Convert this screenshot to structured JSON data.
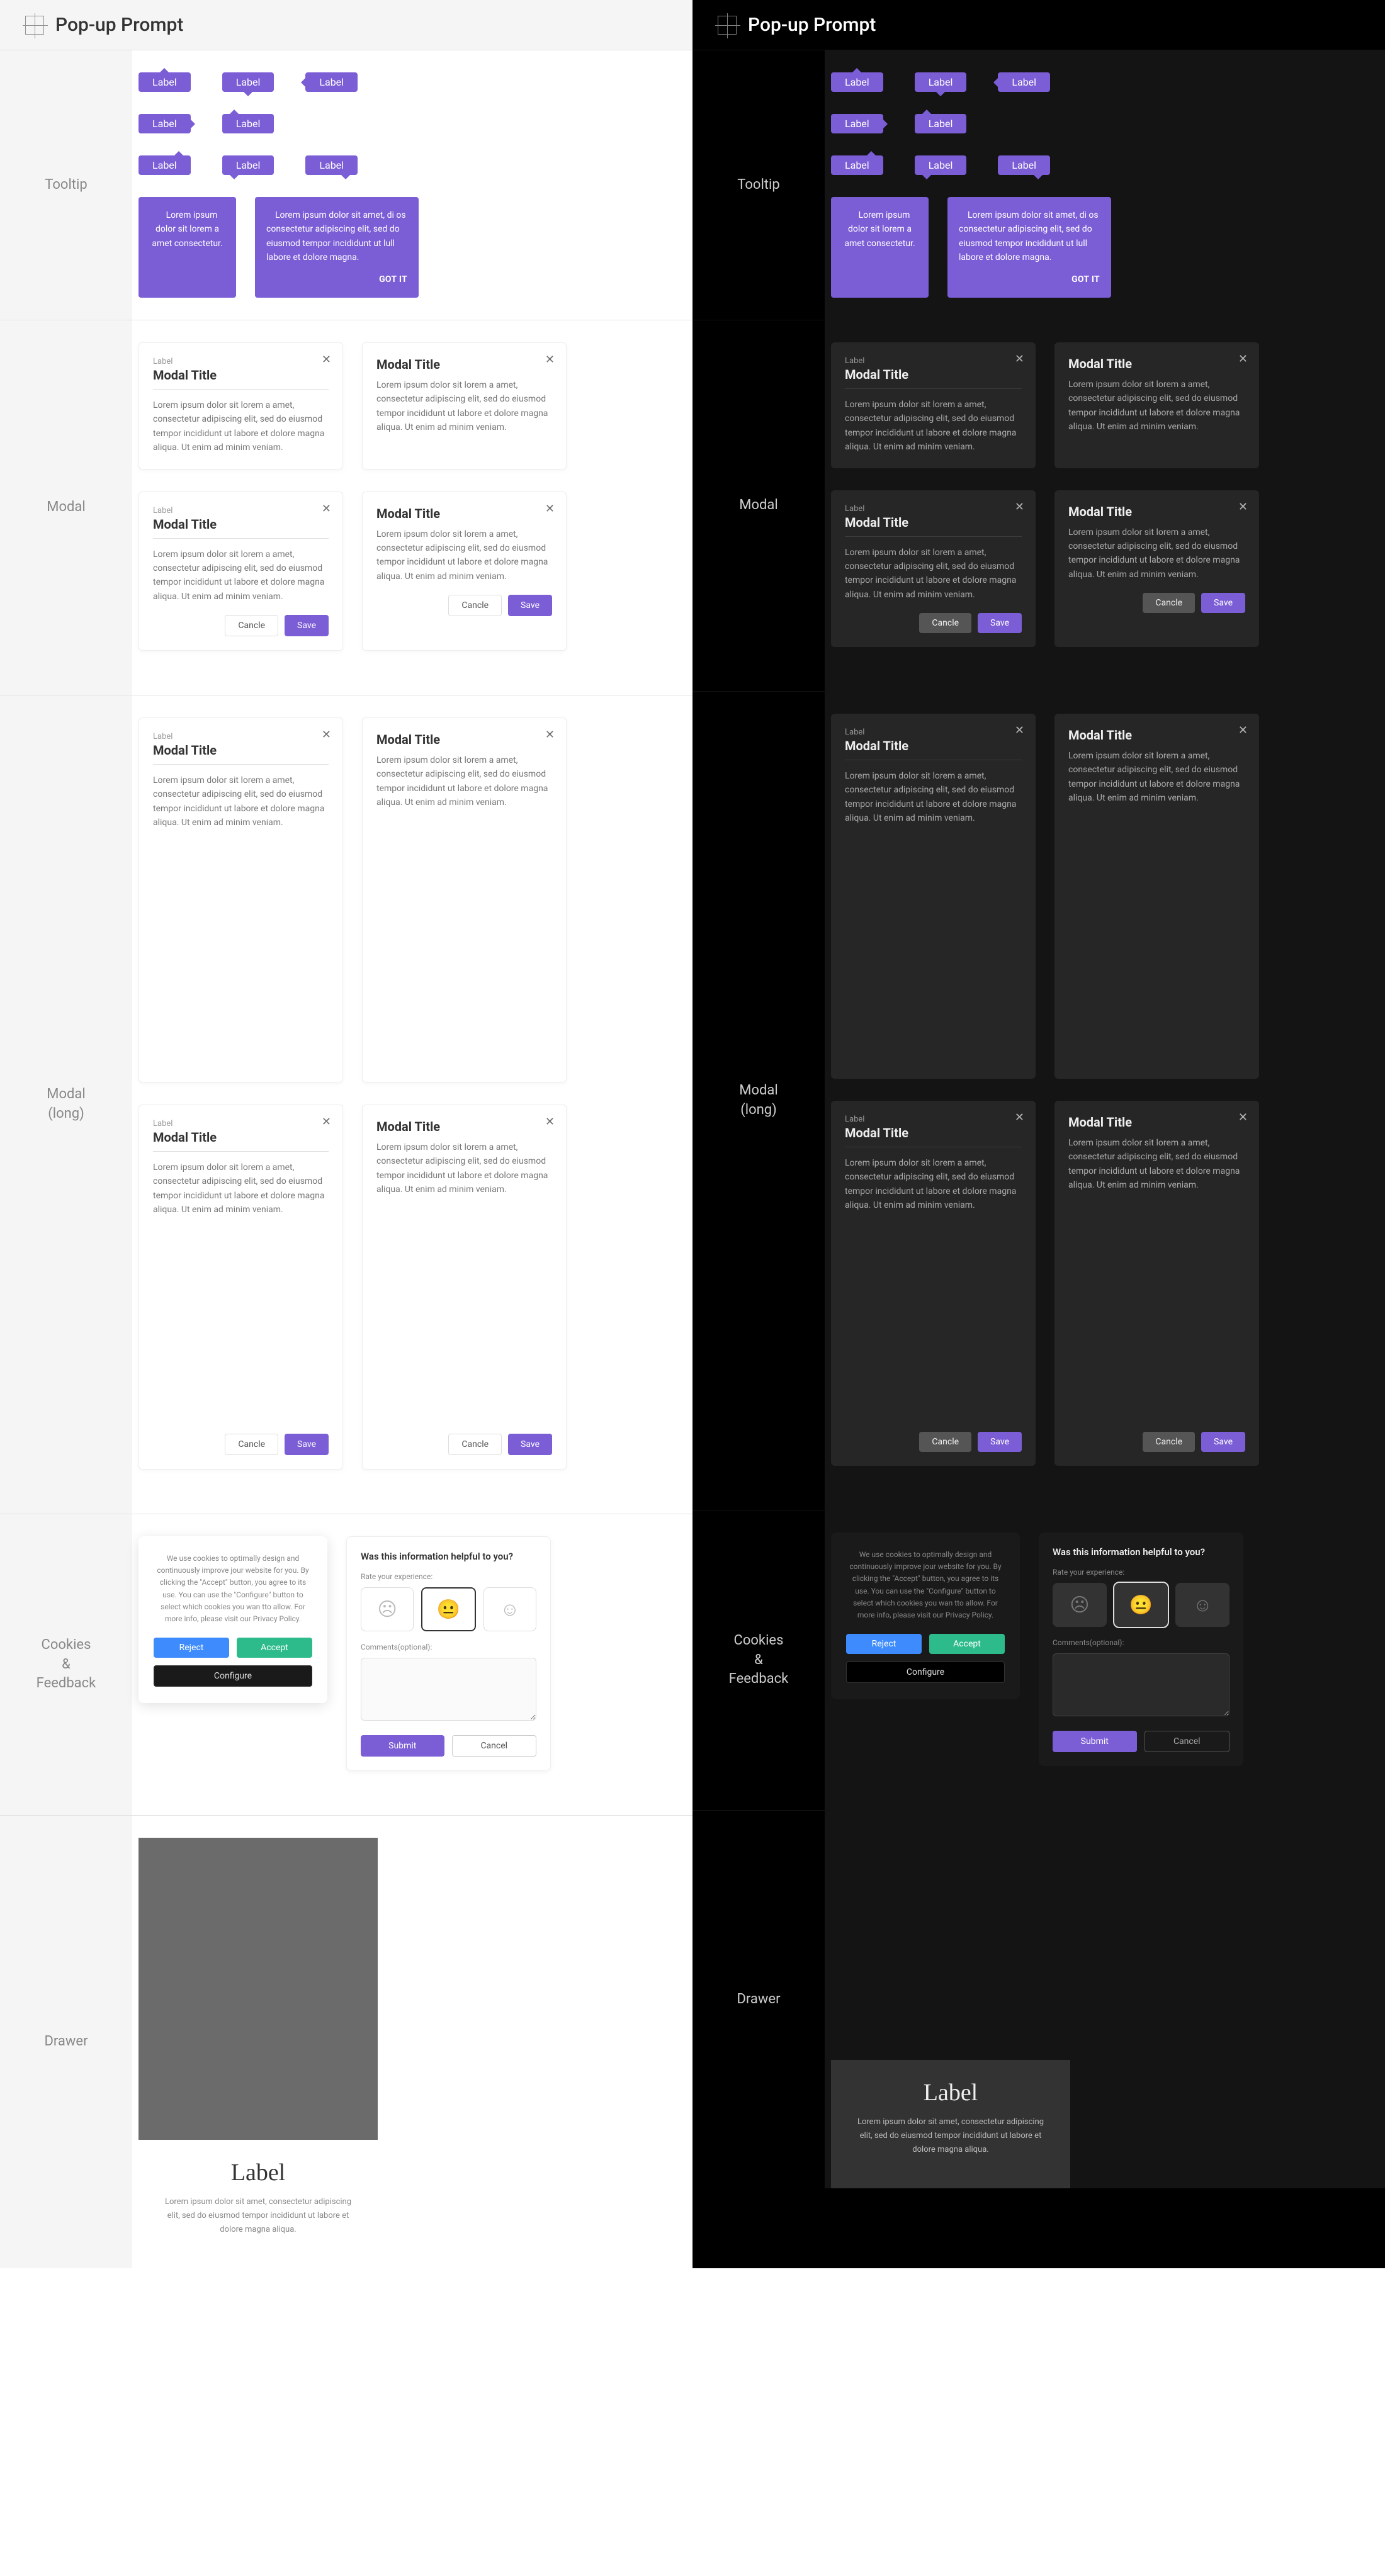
{
  "header": {
    "title": "Pop-up Prompt"
  },
  "sections": {
    "tooltip": "Tooltip",
    "modal": "Modal",
    "modal_long": "Modal\n(long)",
    "cookies": "Cookies\n&\nFeedback",
    "drawer": "Drawer"
  },
  "tooltip": {
    "label": "Label",
    "short": "Lorem ipsum dolor sit lorem a amet consectetur.",
    "long": "Lorem ipsum dolor sit amet, di os consectetur adipiscing elit, sed do eiusmod tempor incididunt ut lull labore et dolore magna.",
    "gotit": "GOT IT"
  },
  "modal": {
    "overline": "Label",
    "title": "Modal Title",
    "body_short": "Lorem ipsum dolor sit lorem a amet, consectetur adipiscing elit, sed do eiusmod tempor incididunt ut labore et dolore magna aliqua. Ut enim ad minim veniam.",
    "body_long": "Lorem ipsum dolor sit lorem a amet, consectetur adipiscing elit, sed do eiusmod tempor incididunt ut labore et dolore magna aliqua. Ut enim ad minim veniam.",
    "cancel": "Cancle",
    "save": "Save"
  },
  "cookies": {
    "text": "We use cookies to optimally design and continuously improve jour website for you. By clicking the \"Accept\" button, you agree to its use. You can use the \"Configure\" button to select which cookies you wan tto allow. For more info, please visit our Privacy Policy.",
    "reject": "Reject",
    "accept": "Accept",
    "configure": "Configure"
  },
  "feedback": {
    "question": "Was this information helpful to you?",
    "rate_label": "Rate your experience:",
    "comments_label": "Comments(optional):",
    "submit": "Submit",
    "cancel": "Cancel"
  },
  "drawer": {
    "label": "Label",
    "text": "Lorem ipsum dolor sit amet, consectetur adipiscing elit, sed do eiusmod tempor incididunt ut labore et dolore magna aliqua."
  }
}
